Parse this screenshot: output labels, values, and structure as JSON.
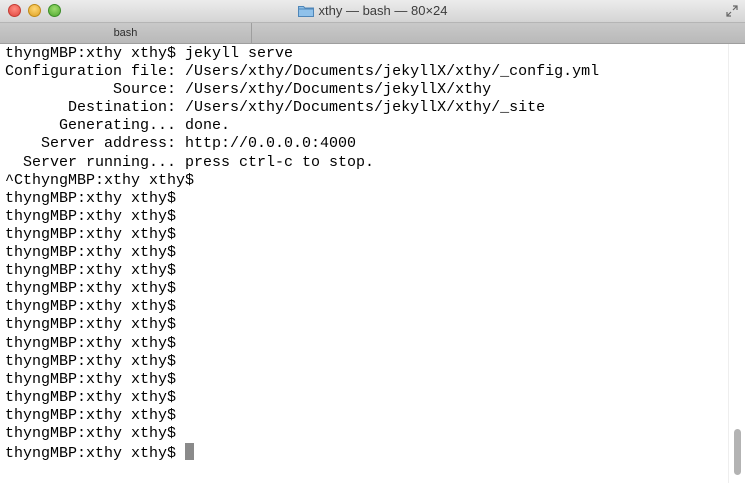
{
  "window": {
    "title": "xthy — bash — 80×24"
  },
  "tabs": [
    {
      "label": "bash"
    }
  ],
  "terminal": {
    "lines": [
      "thyngMBP:xthy xthy$ jekyll serve",
      "Configuration file: /Users/xthy/Documents/jekyllX/xthy/_config.yml",
      "            Source: /Users/xthy/Documents/jekyllX/xthy",
      "       Destination: /Users/xthy/Documents/jekyllX/xthy/_site",
      "      Generating... done.",
      "    Server address: http://0.0.0.0:4000",
      "  Server running... press ctrl-c to stop.",
      "^CthyngMBP:xthy xthy$",
      "thyngMBP:xthy xthy$",
      "thyngMBP:xthy xthy$",
      "thyngMBP:xthy xthy$",
      "thyngMBP:xthy xthy$",
      "thyngMBP:xthy xthy$",
      "thyngMBP:xthy xthy$",
      "thyngMBP:xthy xthy$",
      "thyngMBP:xthy xthy$",
      "thyngMBP:xthy xthy$",
      "thyngMBP:xthy xthy$",
      "thyngMBP:xthy xthy$",
      "thyngMBP:xthy xthy$",
      "thyngMBP:xthy xthy$",
      "thyngMBP:xthy xthy$",
      "thyngMBP:xthy xthy$"
    ],
    "prompt": "thyngMBP:xthy xthy$ ",
    "colors": {
      "background": "#ffffff",
      "text": "#000000",
      "cursor": "#8a8a8a"
    }
  },
  "icons": {
    "title": "folder-icon",
    "fullscreen": "fullscreen-icon"
  }
}
